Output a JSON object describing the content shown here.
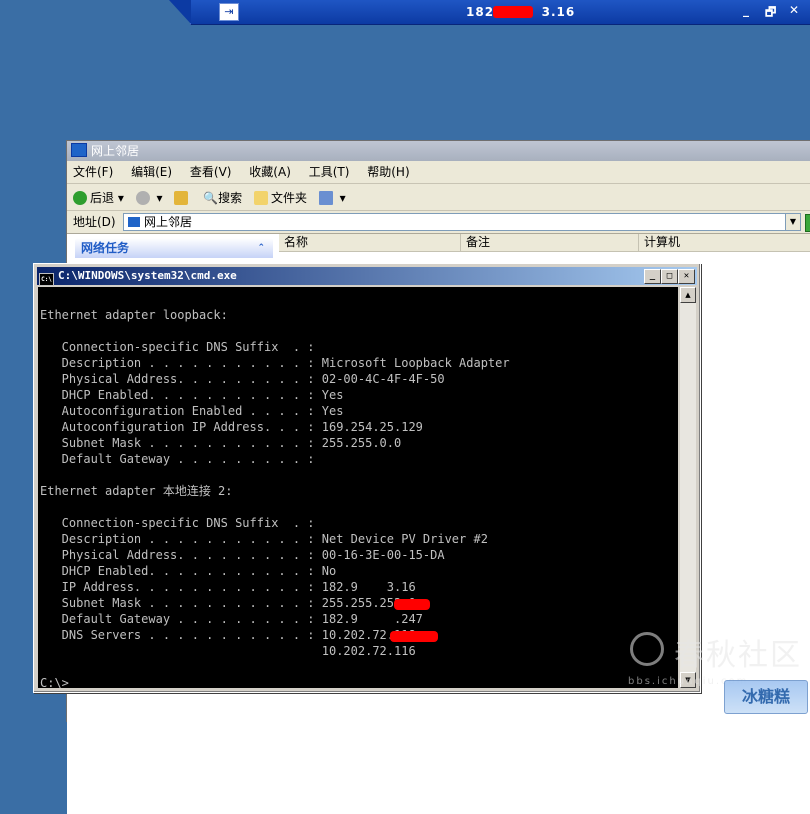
{
  "rdp": {
    "title_prefix": "182.",
    "title_suffix": "3.16",
    "pin_icon": "pin-icon",
    "min_label": "_",
    "restore_label": "🗗",
    "close_label": "✕"
  },
  "explorer": {
    "title": "网上邻居",
    "menu": [
      "文件(F)",
      "编辑(E)",
      "查看(V)",
      "收藏(A)",
      "工具(T)",
      "帮助(H)"
    ],
    "toolbar": {
      "back_label": "后退",
      "search_label": "搜索",
      "folders_label": "文件夹"
    },
    "address": {
      "label": "地址(D)",
      "value": "网上邻居"
    },
    "task_pane_title": "网络任务",
    "columns": [
      "名称",
      "备注",
      "计算机"
    ]
  },
  "cmd": {
    "title": "C:\\WINDOWS\\system32\\cmd.exe",
    "icon_label": "C:\\",
    "min_label": "_",
    "max_label": "□",
    "close_label": "✕",
    "lines": [
      "",
      "Ethernet adapter loopback:",
      "",
      "   Connection-specific DNS Suffix  . :",
      "   Description . . . . . . . . . . . : Microsoft Loopback Adapter",
      "   Physical Address. . . . . . . . . : 02-00-4C-4F-4F-50",
      "   DHCP Enabled. . . . . . . . . . . : Yes",
      "   Autoconfiguration Enabled . . . . : Yes",
      "   Autoconfiguration IP Address. . . : 169.254.25.129",
      "   Subnet Mask . . . . . . . . . . . : 255.255.0.0",
      "   Default Gateway . . . . . . . . . :",
      "",
      "Ethernet adapter 本地连接 2:",
      "",
      "   Connection-specific DNS Suffix  . :",
      "   Description . . . . . . . . . . . : Net Device PV Driver #2",
      "   Physical Address. . . . . . . . . : 00-16-3E-00-15-DA",
      "   DHCP Enabled. . . . . . . . . . . : No",
      "   IP Address. . . . . . . . . . . . : 182.9    3.16",
      "   Subnet Mask . . . . . . . . . . . : 255.255.252.0",
      "   Default Gateway . . . . . . . . . : 182.9     .247",
      "   DNS Servers . . . . . . . . . . . : 10.202.72.118",
      "                                       10.202.72.116",
      "",
      "C:\\>_"
    ]
  },
  "watermark": {
    "text": "春秋社区",
    "url": "bbs.ichunqiu.com",
    "badge": "冰糖糕"
  }
}
